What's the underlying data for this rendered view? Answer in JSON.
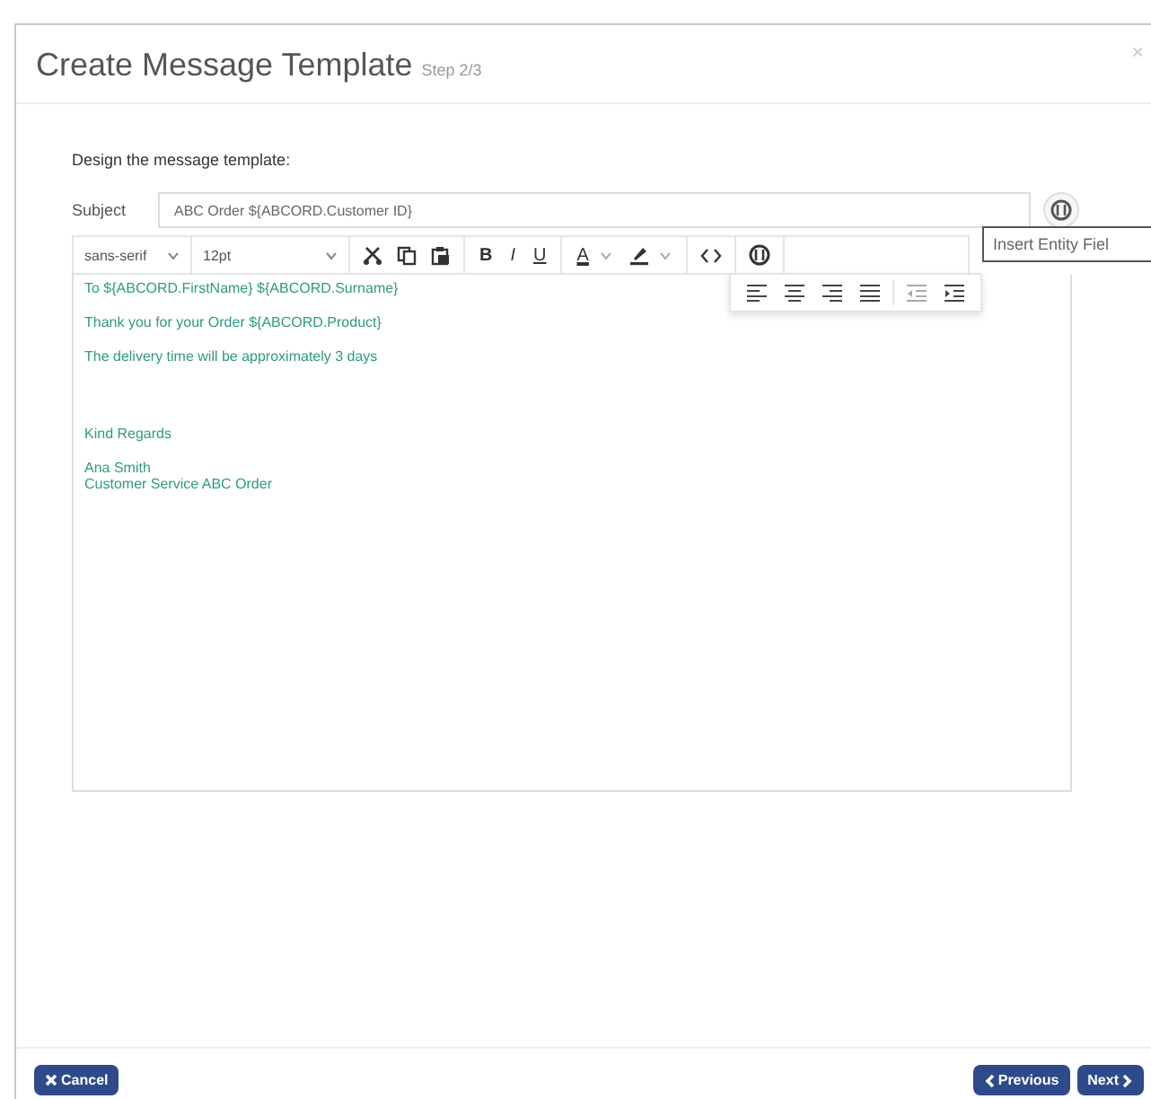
{
  "dialog": {
    "title": "Create Message Template",
    "step": "Step 2/3",
    "close": "×"
  },
  "instruction": "Design the message template:",
  "subject": {
    "label": "Subject",
    "value": "ABC Order ${ABCORD.Customer ID}"
  },
  "toolbar": {
    "font": "sans-serif",
    "size": "12pt",
    "format_buttons": [
      "B",
      "I",
      "U"
    ],
    "font_color_letter": "A"
  },
  "tooltip": "Insert Entity Fiel",
  "body": [
    {
      "lines": [
        "To ${ABCORD.FirstName} ${ABCORD.Surname}"
      ]
    },
    {
      "lines": [
        "Thank you for your Order ${ABCORD.Product}"
      ]
    },
    {
      "lines": [
        "The delivery time will be approximately 3 days"
      ]
    },
    {
      "lines": [
        "Kind Regards"
      ],
      "blank_line_before": true
    },
    {
      "lines": [
        "Ana Smith",
        "Customer Service ABC Order"
      ]
    }
  ],
  "footer": {
    "cancel": "Cancel",
    "previous": "Previous",
    "next": "Next"
  }
}
